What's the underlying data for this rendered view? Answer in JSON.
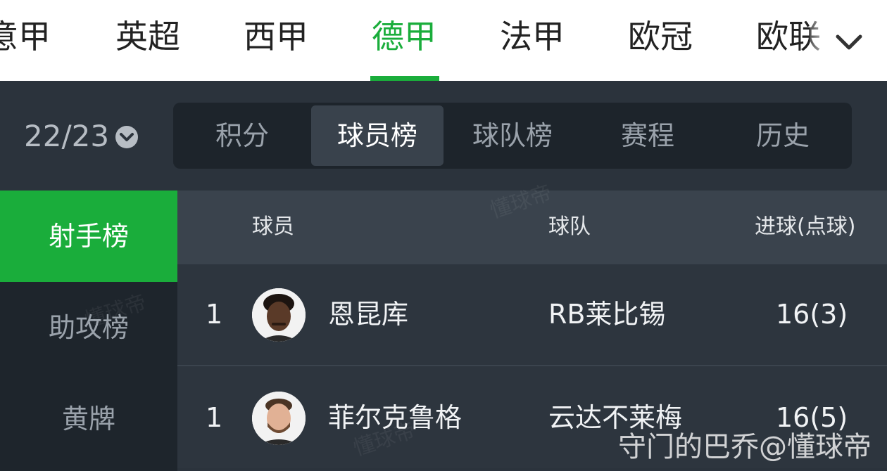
{
  "leagues": [
    "意甲",
    "英超",
    "西甲",
    "德甲",
    "法甲",
    "欧冠",
    "欧联"
  ],
  "active_league": "德甲",
  "season": "22/23",
  "subtabs": [
    "积分",
    "球员榜",
    "球队榜",
    "赛程",
    "历史"
  ],
  "active_subtab": "球员榜",
  "categories": [
    "射手榜",
    "助攻榜",
    "黄牌"
  ],
  "active_category": "射手榜",
  "table": {
    "headers": {
      "player": "球员",
      "team": "球队",
      "goals": "进球(点球)"
    },
    "rows": [
      {
        "rank": "1",
        "player": "恩昆库",
        "team": "RB莱比锡",
        "goals": "16(3)"
      },
      {
        "rank": "1",
        "player": "菲尔克鲁格",
        "team": "云达不莱梅",
        "goals": "16(5)"
      }
    ]
  },
  "watermark": "懂球帝",
  "credit": "守门的巴乔@懂球帝",
  "colors": {
    "accent": "#1aad3b",
    "background": "#2b333c",
    "header_bar": "#ffffff"
  },
  "icons": {
    "league_more": "chevron-down-icon",
    "season": "dropdown-circle-icon"
  }
}
